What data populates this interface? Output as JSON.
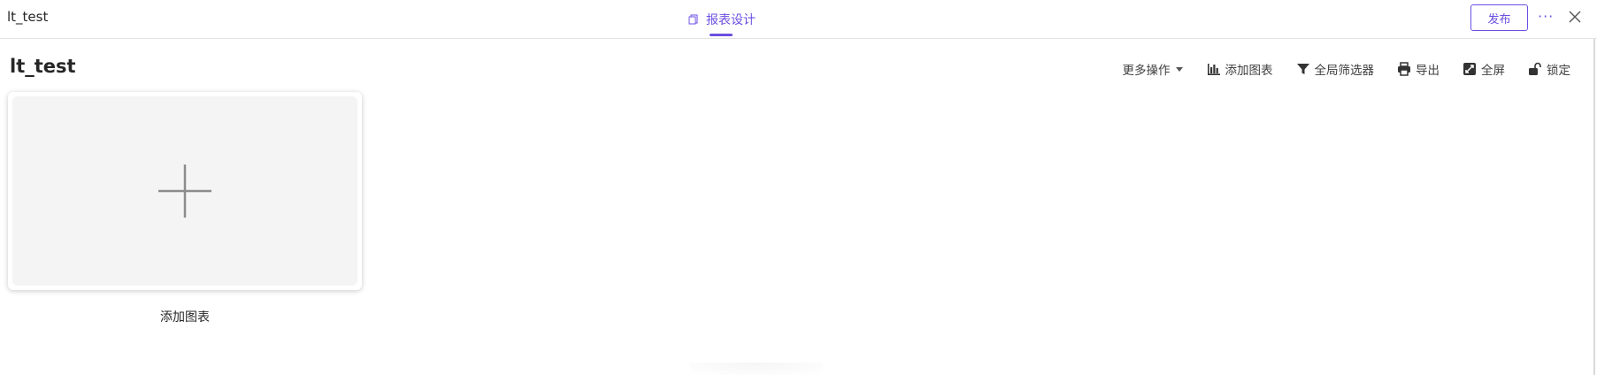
{
  "app": {
    "name": "lt_test"
  },
  "header": {
    "tab_label": "报表设计",
    "publish_label": "发布",
    "more_label": "···",
    "accent_color": "#6c4fe0"
  },
  "dashboard": {
    "title": "lt_test",
    "toolbar": {
      "more_actions": "更多操作",
      "add_chart": "添加图表",
      "global_filter": "全局筛选器",
      "export": "导出",
      "fullscreen": "全屏",
      "lock": "锁定"
    },
    "add_card_label": "添加图表"
  },
  "icons": [
    "report-design-icon",
    "close-icon",
    "caret-down-icon",
    "bar-chart-icon",
    "filter-icon",
    "printer-icon",
    "fullscreen-icon",
    "unlock-icon",
    "plus-icon"
  ]
}
